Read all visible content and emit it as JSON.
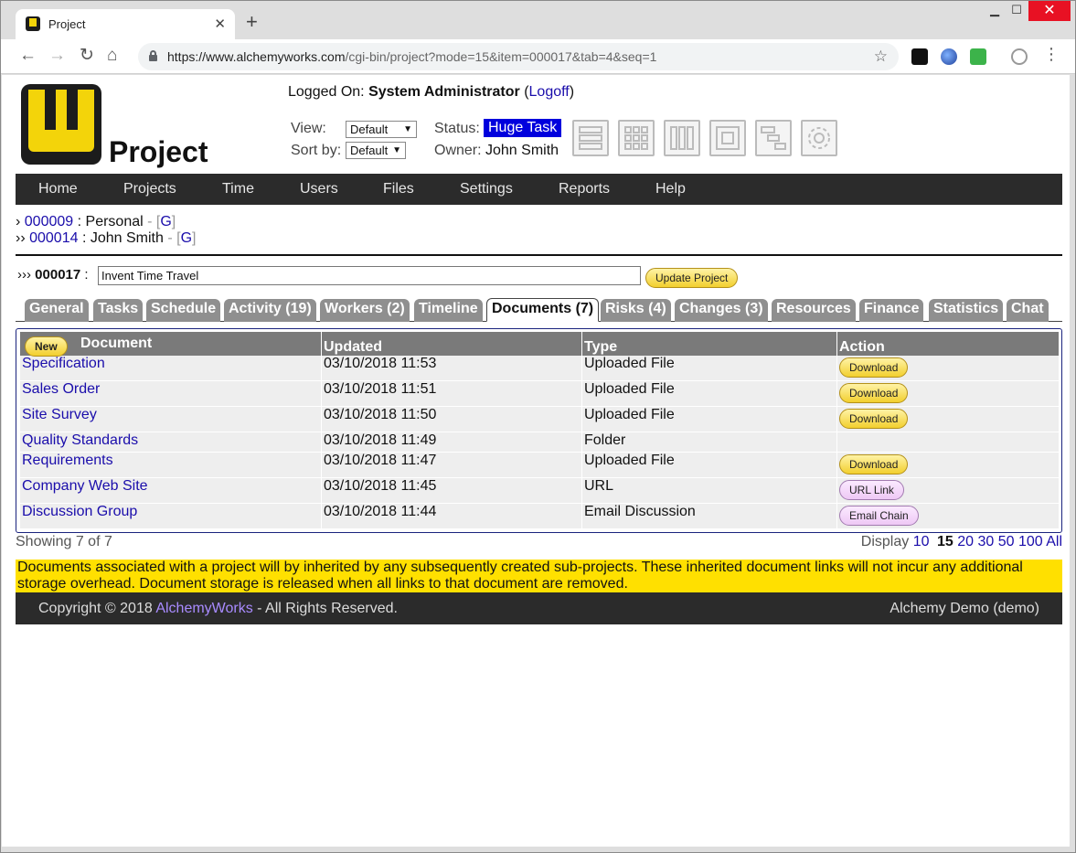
{
  "browser": {
    "tab_title": "Project",
    "url_host": "https://www.alchemyworks.com",
    "url_path": "/cgi-bin/project?mode=15&item=000017&tab=4&seq=1"
  },
  "header": {
    "brand": "Project",
    "logged_on_label": "Logged On:",
    "user": "System Administrator",
    "logoff": "Logoff",
    "view_label": "View:",
    "view_value": "Default",
    "sortby_label": "Sort by:",
    "sortby_value": "Default",
    "status_label": "Status:",
    "status_value": "Huge Task",
    "owner_label": "Owner:",
    "owner_value": "John Smith",
    "status_color": "#0000dd"
  },
  "view_icons": [
    "list-view-icon",
    "grid-view-icon",
    "column-view-icon",
    "nested-view-icon",
    "gantt-view-icon",
    "settings-icon"
  ],
  "nav": [
    "Home",
    "Projects",
    "Time",
    "Users",
    "Files",
    "Settings",
    "Reports",
    "Help"
  ],
  "breadcrumbs": [
    {
      "prefix": "›",
      "id": "000009",
      "name": "Personal",
      "flag": "G"
    },
    {
      "prefix": "››",
      "id": "000014",
      "name": "John Smith",
      "flag": "G"
    }
  ],
  "project": {
    "prefix": "›››",
    "id": "000017",
    "name": "Invent Time Travel",
    "update_label": "Update Project"
  },
  "tabs": [
    {
      "label": "General"
    },
    {
      "label": "Tasks"
    },
    {
      "label": "Schedule"
    },
    {
      "label": "Activity (19)"
    },
    {
      "label": "Workers (2)"
    },
    {
      "label": "Timeline"
    },
    {
      "label": "Documents (7)",
      "active": true
    },
    {
      "label": "Risks (4)"
    },
    {
      "label": "Changes (3)"
    },
    {
      "label": "Resources"
    },
    {
      "label": "Finance"
    },
    {
      "label": "Statistics"
    },
    {
      "label": "Chat"
    }
  ],
  "documents": {
    "new_label": "New",
    "columns": [
      "Document",
      "Updated",
      "Type",
      "Action"
    ],
    "rows": [
      {
        "name": "Specification",
        "updated": "03/10/2018 11:53",
        "type": "Uploaded File",
        "action": "Download"
      },
      {
        "name": "Sales Order",
        "updated": "03/10/2018 11:51",
        "type": "Uploaded File",
        "action": "Download"
      },
      {
        "name": "Site Survey",
        "updated": "03/10/2018 11:50",
        "type": "Uploaded File",
        "action": "Download"
      },
      {
        "name": "Quality Standards",
        "updated": "03/10/2018 11:49",
        "type": "Folder",
        "action": ""
      },
      {
        "name": "Requirements",
        "updated": "03/10/2018 11:47",
        "type": "Uploaded File",
        "action": "Download"
      },
      {
        "name": "Company Web Site",
        "updated": "03/10/2018 11:45",
        "type": "URL",
        "action": "URL Link"
      },
      {
        "name": "Discussion Group",
        "updated": "03/10/2018 11:44",
        "type": "Email Discussion",
        "action": "Email Chain"
      }
    ],
    "showing": "Showing 7 of 7",
    "display_label": "Display",
    "display_options": [
      "10",
      "15",
      "20",
      "30",
      "50",
      "100",
      "All"
    ],
    "display_current": "15"
  },
  "note": "Documents associated with a project will by inherited by any subsequently created sub-projects. These inherited document links will not incur any additional storage overhead. Document storage is released when all links to that document are removed.",
  "footer": {
    "copyright": "Copyright © 2018",
    "company": "AlchemyWorks",
    "rights": "- All Rights Reserved.",
    "instance": "Alchemy Demo (demo)"
  }
}
